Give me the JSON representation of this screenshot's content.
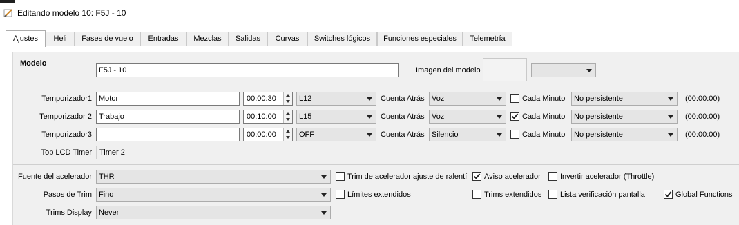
{
  "window": {
    "title": "Editando modelo 10: F5J - 10"
  },
  "tabs": [
    "Ajustes",
    "Heli",
    "Fases de vuelo",
    "Entradas",
    "Mezclas",
    "Salidas",
    "Curvas",
    "Switches lógicos",
    "Funciones especiales",
    "Telemetría"
  ],
  "modelo": {
    "label": "Modelo",
    "name_value": "F5J - 10",
    "image_label": "Imagen del modelo",
    "image_select_value": ""
  },
  "timers": [
    {
      "label": "Temporizador1",
      "name": "Motor",
      "time": "00:00:30",
      "source": "L12",
      "countdown_label": "Cuenta Atrás",
      "countdown": "Voz",
      "minute_label": "Cada Minuto",
      "minute_checked": false,
      "persistence": "No persistente",
      "value": "(00:00:00)"
    },
    {
      "label": "Temporizador 2",
      "name": "Trabajo",
      "time": "00:10:00",
      "source": "L15",
      "countdown_label": "Cuenta Atrás",
      "countdown": "Voz",
      "minute_label": "Cada Minuto",
      "minute_checked": true,
      "persistence": "No persistente",
      "value": "(00:00:00)"
    },
    {
      "label": "Temporizador3",
      "name": "",
      "time": "00:00:00",
      "source": "OFF",
      "countdown_label": "Cuenta Atrás",
      "countdown": "Silencio",
      "minute_label": "Cada Minuto",
      "minute_checked": false,
      "persistence": "No persistente",
      "value": "(00:00:00)"
    }
  ],
  "top_lcd": {
    "label": "Top LCD Timer",
    "value": "Timer 2"
  },
  "throttle": {
    "source_label": "Fuente del acelerador",
    "source_value": "THR",
    "idle_trim_label": "Trim de acelerador ajuste de ralentí",
    "idle_trim_checked": false,
    "warning_label": "Aviso acelerador",
    "warning_checked": true,
    "invert_label": "Invertir acelerador (Throttle)",
    "invert_checked": false
  },
  "trim": {
    "steps_label": "Pasos de Trim",
    "steps_value": "Fino",
    "extended_limits_label": "Límites extendidos",
    "extended_limits_checked": false,
    "extended_trims_label": "Trims extendidos",
    "extended_trims_checked": false,
    "checklist_label": "Lista verificación pantalla",
    "checklist_checked": false,
    "global_functions_label": "Global Functions",
    "global_functions_checked": true,
    "display_label": "Trims Display",
    "display_value": "Never"
  },
  "colors": {
    "panel_bg": "#f0f0f0",
    "combo_bg": "#e5e5e5",
    "border": "#adadad"
  }
}
